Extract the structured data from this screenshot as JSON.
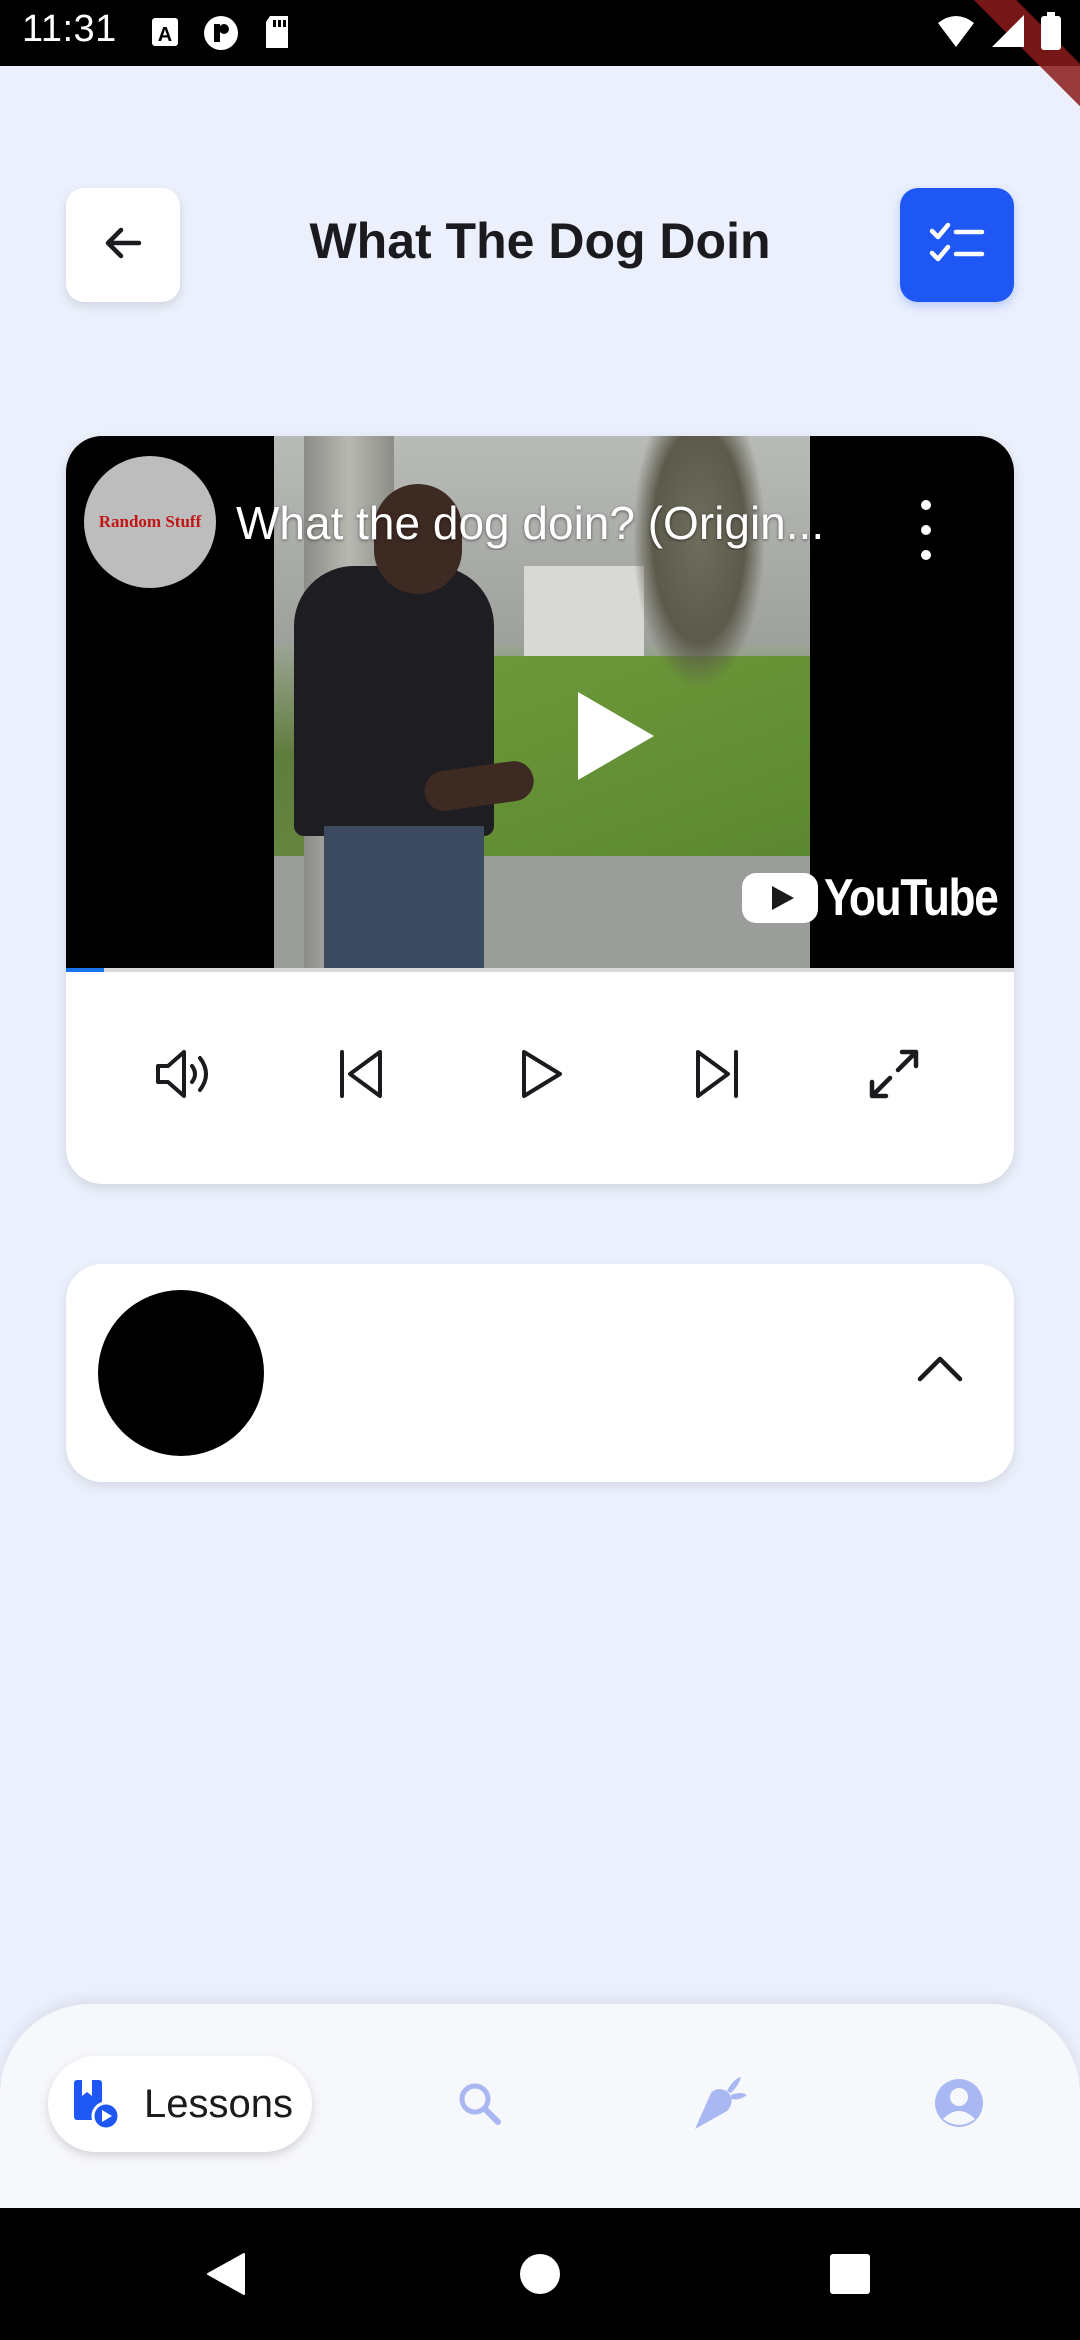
{
  "status_bar": {
    "time": "11:31",
    "left_icons": [
      "a-icon",
      "circle-p-icon",
      "sd-card-icon"
    ],
    "right_icons": [
      "wifi-icon",
      "signal-icon",
      "battery-icon"
    ]
  },
  "header": {
    "title": "What The Dog Doin",
    "back_icon": "arrow-left-icon",
    "action_icon": "checklist-icon",
    "accent_color": "#1F57F5"
  },
  "video": {
    "channel_name": "Random Stuff",
    "title": "What the dog doin? (Origin...",
    "brand": "YouTube",
    "progress": 0.04
  },
  "controls": [
    "volume-icon",
    "skip-previous-icon",
    "play-icon",
    "skip-next-icon",
    "fullscreen-icon"
  ],
  "collapse_panel": {
    "chevron_icon": "chevron-up-icon"
  },
  "bottom_nav": {
    "lessons_label": "Lessons",
    "items": [
      "lessons-icon",
      "search-icon",
      "carrot-icon",
      "account-icon"
    ],
    "inactive_color": "#A9B8F2"
  },
  "system_nav": [
    "back-triangle-icon",
    "home-circle-icon",
    "recents-square-icon"
  ]
}
